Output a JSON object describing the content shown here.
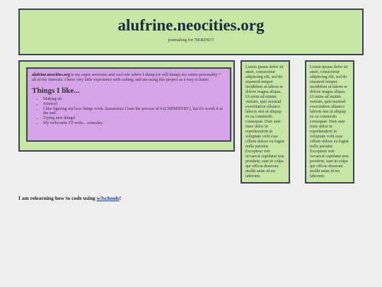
{
  "header": {
    "title": "alufrine.neocities.org",
    "tagline": "journaling for NERDS!!!"
  },
  "main": {
    "intro_bold": "alufrine.neocities.org",
    "intro_text": " is my super awesome and cool site where I dump (or will dump) my entire personality + all of my interests. I have very little experience with coding, and am using this project as a way to learn!",
    "things_heading": "Things I like...",
    "things": [
      "Making art",
      "Science!",
      "I like figuring out how things work. Sometimes I hate the process of it (CHEMISTRY), but it's worth it in the end.",
      "Trying new things!",
      "My webcomic I'll write... someday.."
    ]
  },
  "sidebars": [
    {
      "text": "Lorem ipsum dolor sit amet, consectetur adipiscing elit, sed do eiusmod tempor incididunt ut labore et dolore magna aliqua. Ut enim ad minim veniam, quis nostrud exercitation ullamco laboris nisi ut aliquip ex ea commodo consequat. Duis aute irure dolor in reprehenderit in voluptate velit esse cillum dolore eu fugiat nulla pariatur. Excepteur sint occaecat cupidatat non proident, sunt in culpa qui officia deserunt mollit anim id est laborum."
    },
    {
      "text": "Lorem ipsum dolor sit amet, consectetur adipiscing elit, sed do eiusmod tempor incididunt ut labore et dolore magna aliqua. Ut enim ad minim veniam, quis nostrud exercitation ullamco laboris nisi ut aliquip ex ea commodo consequat. Duis aute irure dolor in reprehenderit in voluptate velit esse cillum dolore eu fugiat nulla pariatur. Excepteur sint occaecat cupidatat non proident, sunt in culpa qui officia deserunt mollit anim id est laborum."
    }
  ],
  "footer": {
    "text_before": "I am relearning how to code using ",
    "link_label": "w3schools",
    "text_after": "!"
  },
  "colors": {
    "background": "#efefef",
    "panel_green": "#c7e6a5",
    "panel_purple": "#d6a2e8",
    "border": "#3d4650",
    "link": "#1a3d8f"
  }
}
